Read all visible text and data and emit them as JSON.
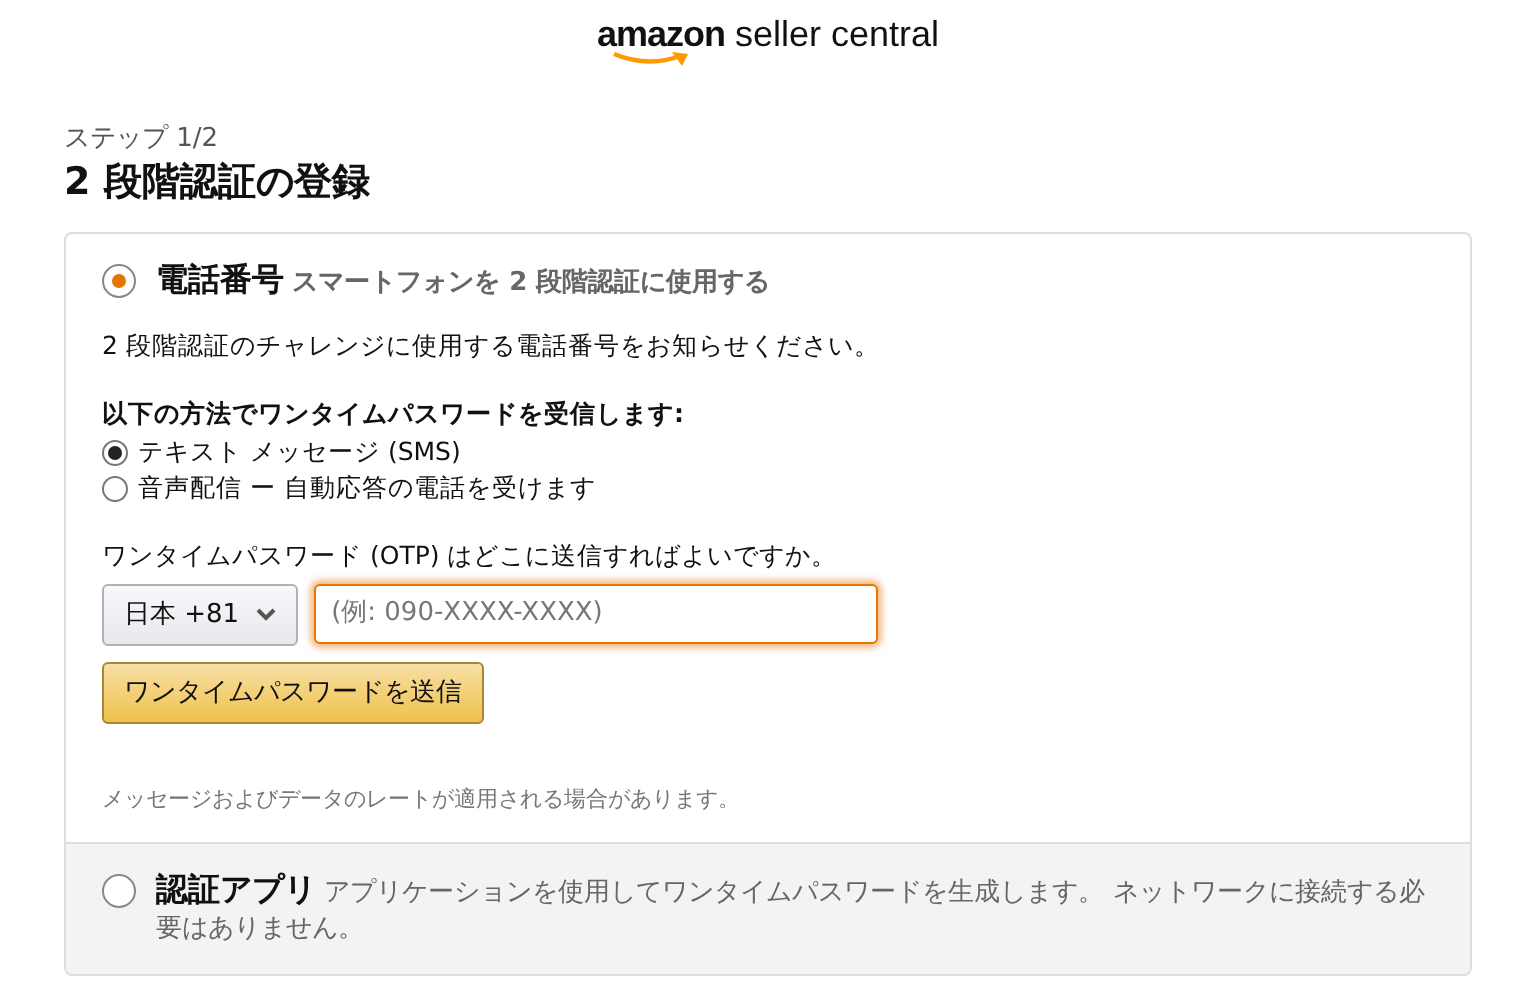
{
  "logo": {
    "brand": "amazon",
    "product": "seller central"
  },
  "step": "ステップ 1/2",
  "title": "2 段階認証の登録",
  "methods": [
    {
      "kind": "phone",
      "label": "電話番号",
      "description": "スマートフォンを 2 段階認証に使用する",
      "selected": true
    },
    {
      "kind": "app",
      "label": "認証アプリ",
      "description": "アプリケーションを使用してワンタイムパスワードを生成します。 ネットワークに接続する必要はありません。",
      "selected": false
    }
  ],
  "phone_panel": {
    "intro": "2 段階認証のチャレンジに使用する電話番号をお知らせください。",
    "delivery_heading": "以下の方法でワンタイムパスワードを受信します:",
    "delivery_options": [
      {
        "label": "テキスト メッセージ (SMS)",
        "selected": true
      },
      {
        "label": "音声配信 ー 自動応答の電話を受けます",
        "selected": false
      }
    ],
    "otp_question": "ワンタイムパスワード (OTP) はどこに送信すればよいですか。",
    "country_select": {
      "value": "日本 +81"
    },
    "phone_field": {
      "placeholder": "(例: 090-XXXX-XXXX)",
      "focused": true
    },
    "send_button": "ワンタイムパスワードを送信",
    "disclaimer": "メッセージおよびデータのレートが適用される場合があります。"
  }
}
